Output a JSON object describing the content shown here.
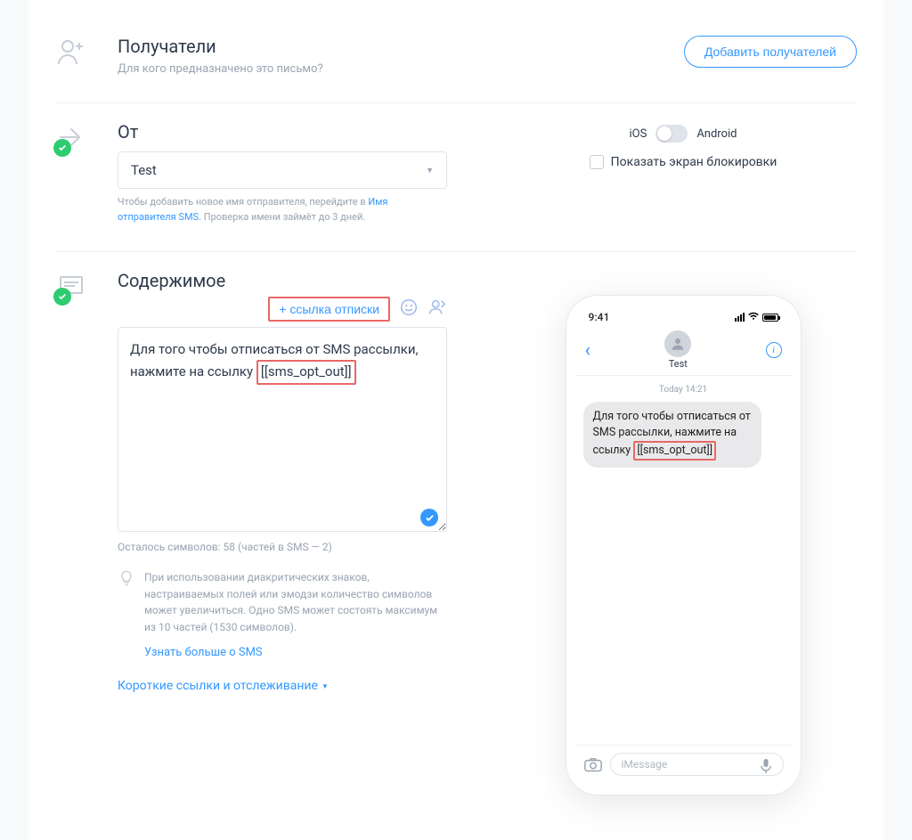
{
  "recipients": {
    "title": "Получатели",
    "subtitle": "Для кого предназначено это письмо?",
    "add_button": "Добавить получателей"
  },
  "from": {
    "title": "От",
    "selected": "Test",
    "hint_prefix": "Чтобы добавить новое имя отправителя, перейдите в",
    "hint_link": "Имя отправителя SMS.",
    "hint_suffix": "Проверка имени займёт до 3 дней."
  },
  "content": {
    "title": "Содержимое",
    "opt_out_button": "+ ссылка отписки",
    "message_prefix": "Для того чтобы отписаться от SMS рассылки, нажмите на ссылку",
    "token": "[[sms_opt_out]]",
    "counter": "Осталось символов: 58 (частей в SMS — 2)",
    "tip": "При использовании диакритических знаков, настраиваемых полей или эмодзи количество символов может увеличиться. Одно SMS может состоять максимум из 10 частей (1530 символов).",
    "learn_more": "Узнать больше о SMS",
    "tracking": "Короткие ссылки и отслеживание"
  },
  "preview": {
    "platform_ios": "iOS",
    "platform_android": "Android",
    "lockscreen": "Показать экран блокировки",
    "time": "9:41",
    "contact": "Test",
    "msg_time": "Today 14:21",
    "bubble_prefix": "Для того чтобы отписаться от SMS рассылки, нажмите на ссылку",
    "bubble_token": "[[sms_opt_out]]",
    "input_placeholder": "iMessage"
  }
}
